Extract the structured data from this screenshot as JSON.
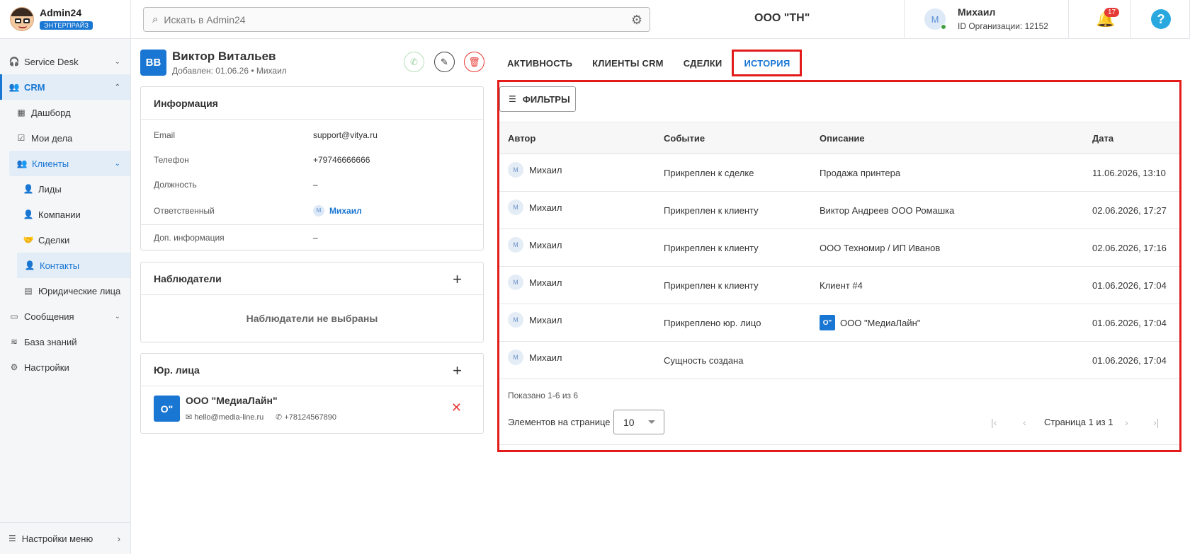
{
  "brand": {
    "name": "Admin24",
    "badge": "ЭНТЕРПРАЙЗ"
  },
  "sidebar": {
    "items": [
      {
        "label": "Service Desk",
        "icon": "headset-icon"
      },
      {
        "label": "CRM",
        "icon": "users-icon"
      },
      {
        "label": "Дашборд",
        "icon": "dashboard-icon"
      },
      {
        "label": "Мои дела",
        "icon": "calendar-check-icon"
      },
      {
        "label": "Клиенты",
        "icon": "clients-icon"
      },
      {
        "label": "Лиды",
        "icon": "person-icon"
      },
      {
        "label": "Компании",
        "icon": "person-icon"
      },
      {
        "label": "Сделки",
        "icon": "handshake-icon"
      },
      {
        "label": "Контакты",
        "icon": "person-icon"
      },
      {
        "label": "Юридические лица",
        "icon": "building-icon"
      },
      {
        "label": "Сообщения",
        "icon": "message-icon"
      },
      {
        "label": "База знаний",
        "icon": "database-icon"
      },
      {
        "label": "Настройки",
        "icon": "gear-icon"
      }
    ],
    "bottom": "Настройки меню"
  },
  "header": {
    "search_placeholder": "Искать в Admin24",
    "org": "ООО \"ТН\"",
    "user_initial": "М",
    "user_name": "Михаил",
    "user_org_id": "ID Организации: 12152",
    "notifications": "17",
    "help": "?"
  },
  "contact": {
    "initials": "ВВ",
    "name": "Виктор Витальев",
    "added": "Добавлен: 01.06.26 • Михаил",
    "info_title": "Информация",
    "fields": [
      {
        "label": "Email",
        "value": "support@vitya.ru"
      },
      {
        "label": "Телефон",
        "value": "+79746666666"
      },
      {
        "label": "Должность",
        "value": "–"
      },
      {
        "label": "Ответственный",
        "value": "Михаил",
        "avatar": "М"
      },
      {
        "label": "Доп. информация",
        "value": "–"
      }
    ],
    "observers_title": "Наблюдатели",
    "observers_empty": "Наблюдатели не выбраны",
    "legal_title": "Юр. лица",
    "legal": {
      "icon": "О\"",
      "name": "ООО \"МедиаЛайн\"",
      "email": "hello@media-line.ru",
      "phone": "+78124567890"
    }
  },
  "tabs": [
    "АКТИВНОСТЬ",
    "КЛИЕНТЫ CRM",
    "СДЕЛКИ",
    "ИСТОРИЯ"
  ],
  "history": {
    "filter_label": "ФИЛЬТРЫ",
    "columns": [
      "Автор",
      "Событие",
      "Описание",
      "Дата"
    ],
    "rows": [
      {
        "avatar": "М",
        "author": "Михаил",
        "event": "Прикреплен к сделке",
        "desc": "Продажа принтера",
        "date": "11.06.2026, 13:10"
      },
      {
        "avatar": "М",
        "author": "Михаил",
        "event": "Прикреплен к клиенту",
        "desc": "Виктор Андреев ООО Ромашка",
        "date": "02.06.2026, 17:27"
      },
      {
        "avatar": "М",
        "author": "Михаил",
        "event": "Прикреплен к клиенту",
        "desc": "ООО Техномир / ИП Иванов",
        "date": "02.06.2026, 17:16"
      },
      {
        "avatar": "М",
        "author": "Михаил",
        "event": "Прикреплен к клиенту",
        "desc": "Клиент #4",
        "date": "01.06.2026, 17:04"
      },
      {
        "avatar": "М",
        "author": "Михаил",
        "event": "Прикреплено юр. лицо",
        "desc": "ООО \"МедиаЛайн\"",
        "desc_icon": "О\"",
        "date": "01.06.2026, 17:04"
      },
      {
        "avatar": "М",
        "author": "Михаил",
        "event": "Сущность создана",
        "desc": "",
        "date": "01.06.2026, 17:04"
      }
    ],
    "shown": "Показано 1-6 из 6",
    "per_page_label": "Элементов на странице",
    "per_page": "10",
    "page_text": "Страница 1 из 1"
  }
}
